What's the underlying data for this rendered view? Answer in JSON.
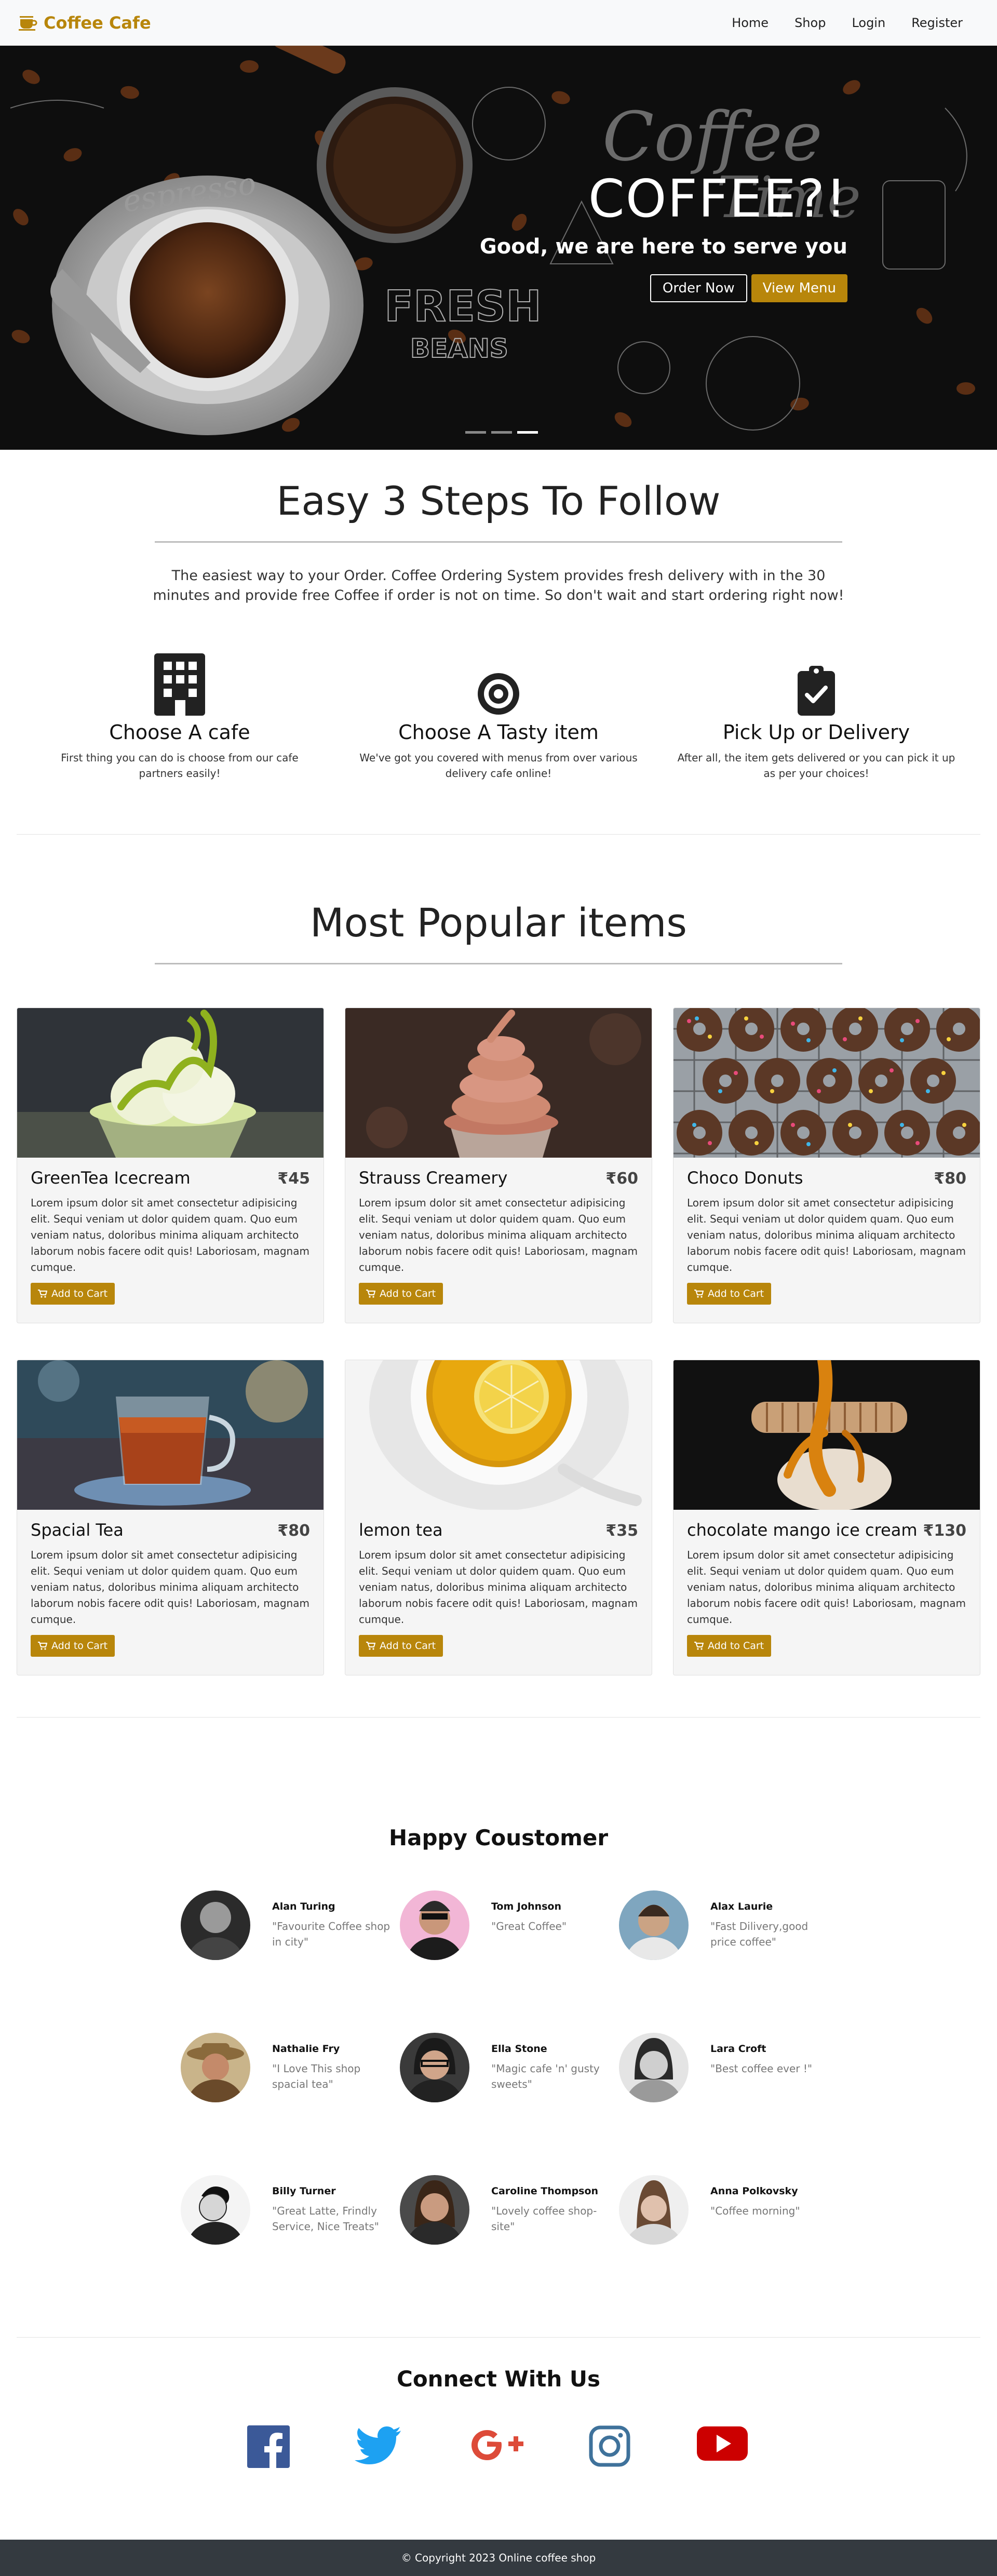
{
  "nav": {
    "brand": "Coffee Cafe",
    "links": [
      "Home",
      "Shop",
      "Login",
      "Register"
    ]
  },
  "hero": {
    "title": "COFFEE?!",
    "subtitle": "Good, we are here to serve you",
    "order_now": "Order Now",
    "view_menu": "View Menu",
    "background_texts": [
      "Coffee",
      "Time",
      "espresso",
      "FRESH",
      "BEANS"
    ]
  },
  "steps": {
    "title": "Easy 3 Steps To Follow",
    "description": "The easiest way to your Order. Coffee Ordering System provides fresh delivery with in the 30 minutes and provide free Coffee if order is not on time. So don't wait and start ordering right now!",
    "items": [
      {
        "icon": "building-icon",
        "title": "Choose A cafe",
        "desc": "First thing you can do is choose from our cafe partners easily!"
      },
      {
        "icon": "target-icon",
        "title": "Choose A Tasty item",
        "desc": "We've got you covered with menus from over various delivery cafe online!"
      },
      {
        "icon": "clipboard-check-icon",
        "title": "Pick Up or Delivery",
        "desc": "After all, the item gets delivered or you can pick it up as per your choices!"
      }
    ]
  },
  "popular": {
    "title": "Most Popular items",
    "add_to_cart": "Add to Cart",
    "items": [
      {
        "name": "GreenTea Icecream",
        "price": "₹45",
        "desc": "Lorem ipsum dolor sit amet consectetur adipisicing elit. Sequi veniam ut dolor quidem quam. Quo eum veniam natus, doloribus minima aliquam architecto laborum nobis facere odit quis! Laboriosam, magnam cumque."
      },
      {
        "name": "Strauss Creamery",
        "price": "₹60",
        "desc": "Lorem ipsum dolor sit amet consectetur adipisicing elit. Sequi veniam ut dolor quidem quam. Quo eum veniam natus, doloribus minima aliquam architecto laborum nobis facere odit quis! Laboriosam, magnam cumque."
      },
      {
        "name": "Choco Donuts",
        "price": "₹80",
        "desc": "Lorem ipsum dolor sit amet consectetur adipisicing elit. Sequi veniam ut dolor quidem quam. Quo eum veniam natus, doloribus minima aliquam architecto laborum nobis facere odit quis! Laboriosam, magnam cumque."
      },
      {
        "name": "Spacial Tea",
        "price": "₹80",
        "desc": "Lorem ipsum dolor sit amet consectetur adipisicing elit. Sequi veniam ut dolor quidem quam. Quo eum veniam natus, doloribus minima aliquam architecto laborum nobis facere odit quis! Laboriosam, magnam cumque."
      },
      {
        "name": "lemon tea",
        "price": "₹35",
        "desc": "Lorem ipsum dolor sit amet consectetur adipisicing elit. Sequi veniam ut dolor quidem quam. Quo eum veniam natus, doloribus minima aliquam architecto laborum nobis facere odit quis! Laboriosam, magnam cumque."
      },
      {
        "name": "chocolate mango ice cream",
        "price": "₹130",
        "desc": "Lorem ipsum dolor sit amet consectetur adipisicing elit. Sequi veniam ut dolor quidem quam. Quo eum veniam natus, doloribus minima aliquam architecto laborum nobis facere odit quis! Laboriosam, magnam cumque."
      }
    ]
  },
  "customers": {
    "title": "Happy Coustomer",
    "items": [
      {
        "name": "Alan Turing",
        "quote": "\"Favourite Coffee shop in city\""
      },
      {
        "name": "Tom Johnson",
        "quote": "\"Great Coffee\""
      },
      {
        "name": "Alax Laurie",
        "quote": "\"Fast Dilivery,good price coffee\""
      },
      {
        "name": "Nathalie Fry",
        "quote": "\"I Love This shop spacial tea\""
      },
      {
        "name": "Ella Stone",
        "quote": "\"Magic cafe 'n' gusty sweets\""
      },
      {
        "name": "Lara Croft",
        "quote": "\"Best coffee ever !\""
      },
      {
        "name": "Billy Turner",
        "quote": "\"Great Latte, Frindly Service, Nice Treats\""
      },
      {
        "name": "Caroline Thompson",
        "quote": "\"Lovely coffee shop-site\""
      },
      {
        "name": "Anna Polkovsky",
        "quote": "\"Coffee morning\""
      }
    ]
  },
  "connect": {
    "title": "Connect With Us",
    "icons": [
      "facebook-icon",
      "twitter-icon",
      "google-plus-icon",
      "instagram-icon",
      "youtube-icon"
    ]
  },
  "footer": {
    "text": "© Copyright 2023 Online coffee shop"
  },
  "colors": {
    "accent": "#b8860b",
    "footer": "#343a40",
    "facebook": "#3b5998",
    "twitter": "#1da1f2",
    "google": "#dd4b39",
    "instagram": "#3f729b",
    "youtube": "#cc0000"
  }
}
